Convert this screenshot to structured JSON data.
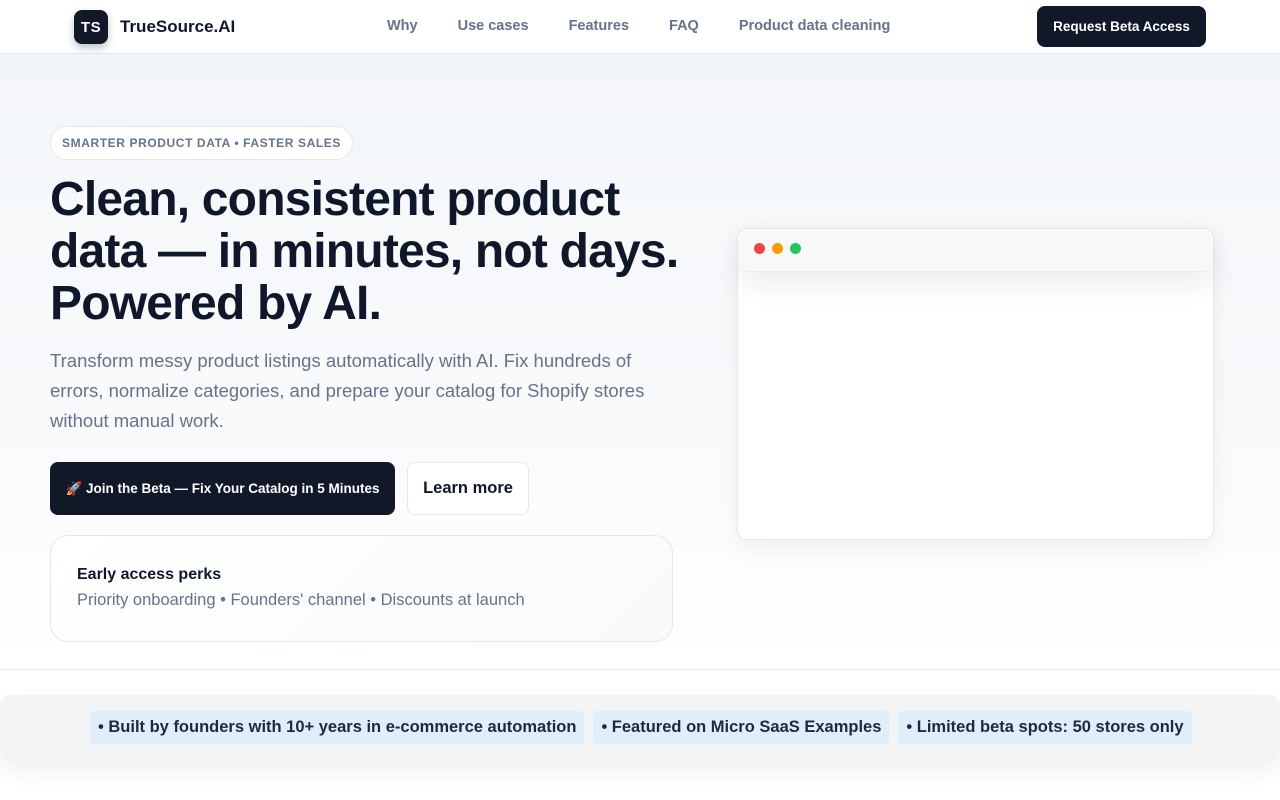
{
  "brand": {
    "logo_mark": "TS",
    "name": "TrueSource.AI"
  },
  "nav": {
    "items": [
      {
        "label": "Why"
      },
      {
        "label": "Use cases"
      },
      {
        "label": "Features"
      },
      {
        "label": "FAQ"
      },
      {
        "label": "Product data cleaning"
      }
    ],
    "cta_label": "Request Beta Access"
  },
  "hero": {
    "eyebrow": "SMARTER PRODUCT DATA • FASTER SALES",
    "headline": "Clean, consistent product data — in minutes, not days. Powered by AI.",
    "subhead": "Transform messy product listings automatically with AI. Fix hundreds of errors, normalize categories, and prepare your catalog for Shopify stores without manual work.",
    "primary_cta": "🚀 Join the Beta — Fix Your Catalog in 5 Minutes",
    "secondary_cta": "Learn more",
    "perks": {
      "title": "Early access perks",
      "items": "Priority onboarding • Founders' channel • Discounts at launch"
    }
  },
  "trust": {
    "items": [
      {
        "label": "• Built by founders with 10+ years in e-commerce automation"
      },
      {
        "label": "• Featured on Micro SaaS Examples"
      },
      {
        "label": "• Limited beta spots: 50 stores only"
      }
    ]
  },
  "colors": {
    "primary": "#111827",
    "muted_text": "#64748b",
    "trust_pill_bg": "#e0eefb",
    "window_red": "#ef4444",
    "window_yellow": "#f59e0b",
    "window_green": "#22c55e"
  }
}
